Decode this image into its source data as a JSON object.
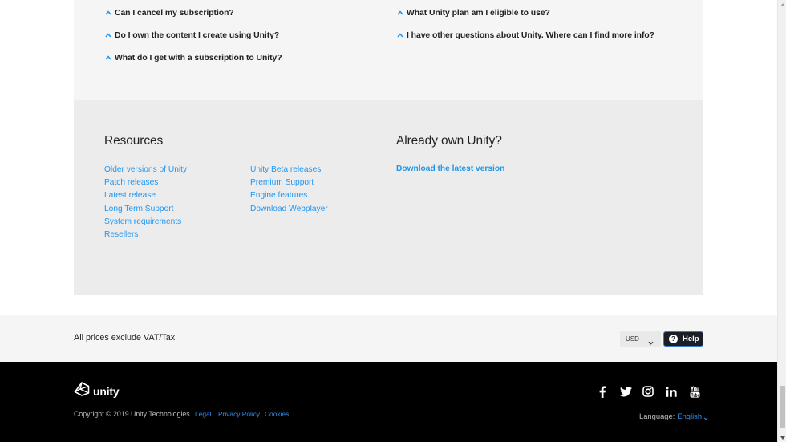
{
  "faq": {
    "left_column": [
      "Can I cancel my subscription?",
      "Do I own the content I create using Unity?",
      "What do I get with a subscription to Unity?"
    ],
    "right_column": [
      "What Unity plan am I eligible to use?",
      "I have other questions about Unity. Where can I find more info?"
    ]
  },
  "resources": {
    "heading": "Resources",
    "column1": [
      "Older versions of Unity",
      "Patch releases",
      "Latest release",
      "Long Term Support",
      "System requirements",
      "Resellers"
    ],
    "column2": [
      "Unity Beta releases",
      "Premium Support",
      "Engine features",
      "Download Webplayer"
    ]
  },
  "already_own": {
    "heading": "Already own Unity?",
    "link": "Download the latest version"
  },
  "price_bar": {
    "vat_note": "All prices exclude VAT/Tax",
    "currency": "USD",
    "help_label": "Help"
  },
  "footer": {
    "logo_text": "unity",
    "copyright": "Copyright © 2019 Unity Technologies",
    "links": [
      "Legal",
      "Privacy Policy",
      "Cookies"
    ],
    "social_icons": [
      "facebook-icon",
      "twitter-icon",
      "instagram-icon",
      "linkedin-icon",
      "youtube-icon"
    ],
    "language_label": "Language:",
    "language_value": "English"
  },
  "colors": {
    "link_blue": "#2196f3",
    "faq_bg": "#f5f5f5",
    "resources_bg": "#ececec",
    "footer_bg": "#000000",
    "help_button_bg": "#1b1e24"
  }
}
